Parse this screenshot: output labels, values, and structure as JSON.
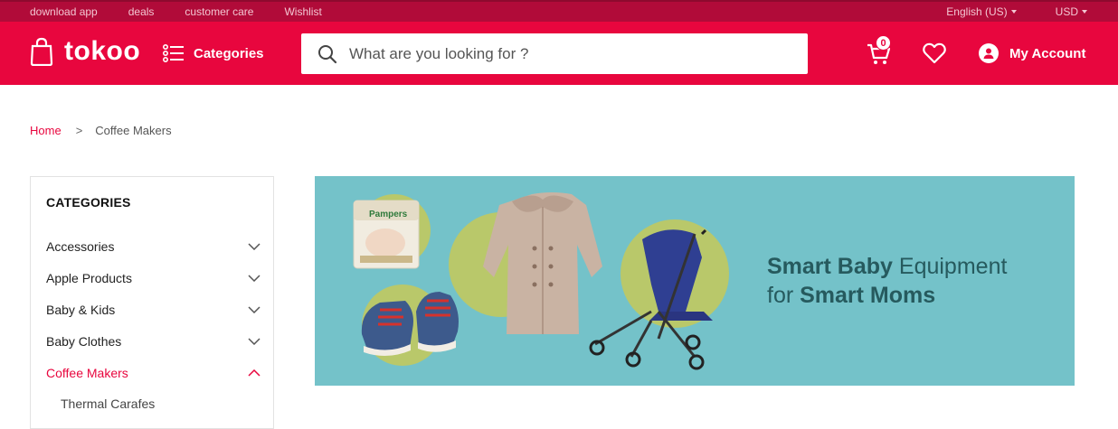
{
  "topbar": {
    "links": [
      "download app",
      "deals",
      "customer care",
      "Wishlist"
    ],
    "language": "English (US)",
    "currency": "USD"
  },
  "header": {
    "logo_text": "tokoo",
    "categories_label": "Categories",
    "search_placeholder": "What are you looking for ?",
    "cart_count": "0",
    "account_label": "My Account"
  },
  "breadcrumb": {
    "home": "Home",
    "separator": ">",
    "current": "Coffee Makers"
  },
  "sidebar": {
    "title": "CATEGORIES",
    "items": [
      {
        "label": "Accessories",
        "expanded": false
      },
      {
        "label": "Apple Products",
        "expanded": false
      },
      {
        "label": "Baby & Kids",
        "expanded": false
      },
      {
        "label": "Baby Clothes",
        "expanded": false
      },
      {
        "label": "Coffee Makers",
        "expanded": true
      }
    ],
    "sub_items": [
      "Thermal Carafes"
    ]
  },
  "banner": {
    "line1_bold": "Smart Baby",
    "line1_rest": " Equipment",
    "line2_pre": "for ",
    "line2_bold": "Smart Moms",
    "diaper_brand": "Pampers"
  },
  "colors": {
    "brand": "#e8063e",
    "topbar": "#b10b39",
    "banner_bg": "#74c2c9",
    "banner_text": "#265a5e",
    "circle": "#b9c86a"
  },
  "icons": [
    "bag-icon",
    "menu-list-icon",
    "search-icon",
    "cart-icon",
    "heart-icon",
    "user-icon",
    "chevron-down-icon",
    "chevron-up-icon"
  ]
}
